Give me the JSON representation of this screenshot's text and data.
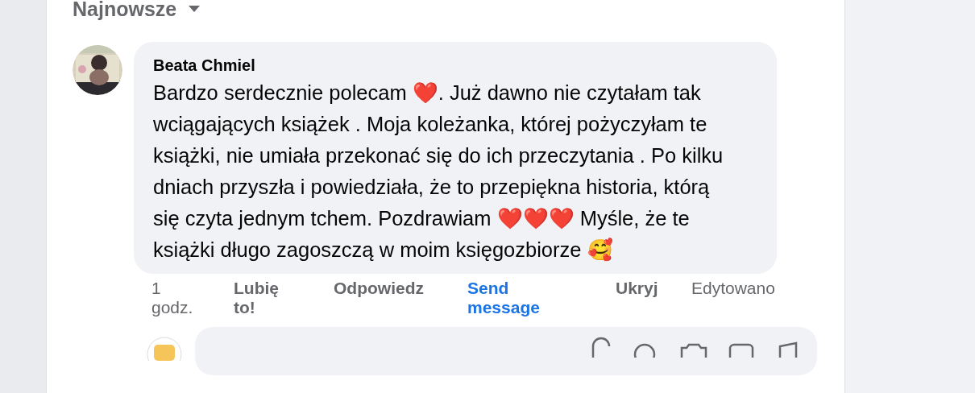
{
  "sort": {
    "label": "Najnowsze"
  },
  "comment": {
    "author": "Beata Chmiel",
    "text": "Bardzo serdecznie polecam ❤️. Już dawno nie czytałam tak wciągających książek . Moja koleżanka, której pożyczyłam te książki, nie umiała przekonać się do ich przeczytania . Po kilku dniach przyszła i powiedziała, że to przepiękna historia, którą się czyta jednym tchem. Pozdrawiam ❤️❤️❤️ Myśle, że te książki długo zagoszczą w moim księgozbiorze 🥰"
  },
  "actions": [
    {
      "kind": "time",
      "label": "1 godz."
    },
    {
      "kind": "action",
      "label": "Lubię to!"
    },
    {
      "kind": "action",
      "label": "Odpowiedz"
    },
    {
      "kind": "link",
      "label": "Send message"
    },
    {
      "kind": "action",
      "label": "Ukryj"
    },
    {
      "kind": "note",
      "label": "Edytowano"
    }
  ]
}
